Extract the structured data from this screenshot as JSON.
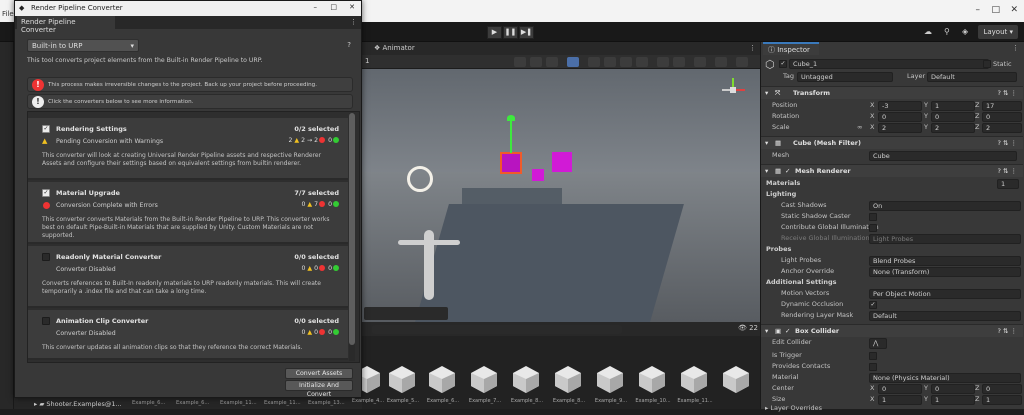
{
  "host": {
    "file_menu": "File",
    "window_controls": [
      "–",
      "□",
      "✕"
    ]
  },
  "toolbar": {
    "layout_label": "Layout",
    "play_icons": [
      "play-icon",
      "pause-icon",
      "step-icon"
    ]
  },
  "scene": {
    "animator_tab": "Animator",
    "layer_number": "1",
    "fps_count": "22"
  },
  "project": {
    "folder": "Shooter.Examples@1...",
    "assets": [
      "Example_4...",
      "Example_5...",
      "Example_6...",
      "Example_7...",
      "Example_8...",
      "Example_8...",
      "Example_9...",
      "Example_10...",
      "Example_11..."
    ],
    "assets_left": [
      "Example_6...",
      "Example_6...",
      "Example_11...",
      "Example_11...",
      "Example_13..."
    ]
  },
  "rpc": {
    "window_title": "Render Pipeline Converter",
    "tab_label": "Render Pipeline Converter",
    "dropdown_value": "Built-in to URP",
    "description": "This tool converts project elements from the Built-in Render Pipeline to URP.",
    "warning_text": "This process makes irreversible changes to the project. Back up your project before proceeding.",
    "info_text": "Click the converters below to see more information.",
    "converters": [
      {
        "title": "Rendering Settings",
        "selected": "0/2 selected",
        "status": "Pending Conversion with Warnings",
        "checked": true,
        "status_icon": "warning-icon",
        "counts": {
          "warn": "2",
          "err": "0",
          "ok": "0",
          "pending": "2"
        },
        "counts_prefix": "2 →",
        "description": "This converter will look at creating Universal Render Pipeline assets and respective Renderer Assets and configure their settings based on equivalent settings from builtin renderer."
      },
      {
        "title": "Material Upgrade",
        "selected": "7/7 selected",
        "status": "Conversion Complete with Errors",
        "checked": true,
        "status_icon": "error-icon",
        "counts": {
          "warn": "0",
          "err": "7",
          "ok": "0",
          "pending": "0"
        },
        "description": "This converter converts Materials from the Built-in Render Pipeline to URP. This converter works best on default Pipe-Built-in Materials that are supplied by Unity. Custom Materials are not supported."
      },
      {
        "title": "Readonly Material Converter",
        "selected": "0/0 selected",
        "status": "Converter Disabled",
        "checked": false,
        "status_icon": "",
        "counts": {
          "warn": "0",
          "err": "0",
          "ok": "0",
          "pending": "0"
        },
        "description": "Converts references to Built-In readonly materials to URP readonly materials. This will create temporarily a .index file and that can take a long time."
      },
      {
        "title": "Animation Clip Converter",
        "selected": "0/0 selected",
        "status": "Converter Disabled",
        "checked": false,
        "status_icon": "",
        "counts": {
          "warn": "0",
          "err": "0",
          "ok": "0",
          "pending": "0"
        },
        "description": "This converter updates all animation clips so that they reference the correct Materials."
      }
    ],
    "convert_button": "Convert Assets",
    "init_convert_button": "Initialize And Convert"
  },
  "inspector": {
    "tab_label": "Inspector",
    "object_name": "Cube_1",
    "static_label": "Static",
    "tag_label": "Tag",
    "tag_value": "Untagged",
    "layer_label": "Layer",
    "layer_value": "Default",
    "transform": {
      "title": "Transform",
      "position": {
        "label": "Position",
        "x": "-3",
        "y": "1",
        "z": "17"
      },
      "rotation": {
        "label": "Rotation",
        "x": "0",
        "y": "0",
        "z": "0"
      },
      "scale": {
        "label": "Scale",
        "x": "2",
        "y": "2",
        "z": "2"
      }
    },
    "mesh_filter": {
      "title": "Cube (Mesh Filter)",
      "mesh_label": "Mesh",
      "mesh_value": "Cube"
    },
    "mesh_renderer": {
      "title": "Mesh Renderer",
      "materials_label": "Materials",
      "materials_count": "1",
      "lighting_label": "Lighting",
      "cast_shadows_label": "Cast Shadows",
      "cast_shadows_value": "On",
      "static_shadow_label": "Static Shadow Caster",
      "contribute_gi_label": "Contribute Global Illumination",
      "receive_gi_label": "Receive Global Illumination",
      "receive_gi_value": "Light Probes",
      "probes_label": "Probes",
      "light_probes_label": "Light Probes",
      "light_probes_value": "Blend Probes",
      "anchor_label": "Anchor Override",
      "anchor_value": "None (Transform)",
      "additional_label": "Additional Settings",
      "motion_label": "Motion Vectors",
      "motion_value": "Per Object Motion",
      "dyn_occ_label": "Dynamic Occlusion",
      "rlm_label": "Rendering Layer Mask",
      "rlm_value": "Default"
    },
    "box_collider": {
      "title": "Box Collider",
      "edit_label": "Edit Collider",
      "trigger_label": "Is Trigger",
      "provides_label": "Provides Contacts",
      "material_label": "Material",
      "material_value": "None (Physics Material)",
      "center": {
        "label": "Center",
        "x": "0",
        "y": "0",
        "z": "0"
      },
      "size": {
        "label": "Size",
        "x": "1",
        "y": "1",
        "z": "1"
      },
      "layer_overrides": "Layer Overrides"
    }
  }
}
